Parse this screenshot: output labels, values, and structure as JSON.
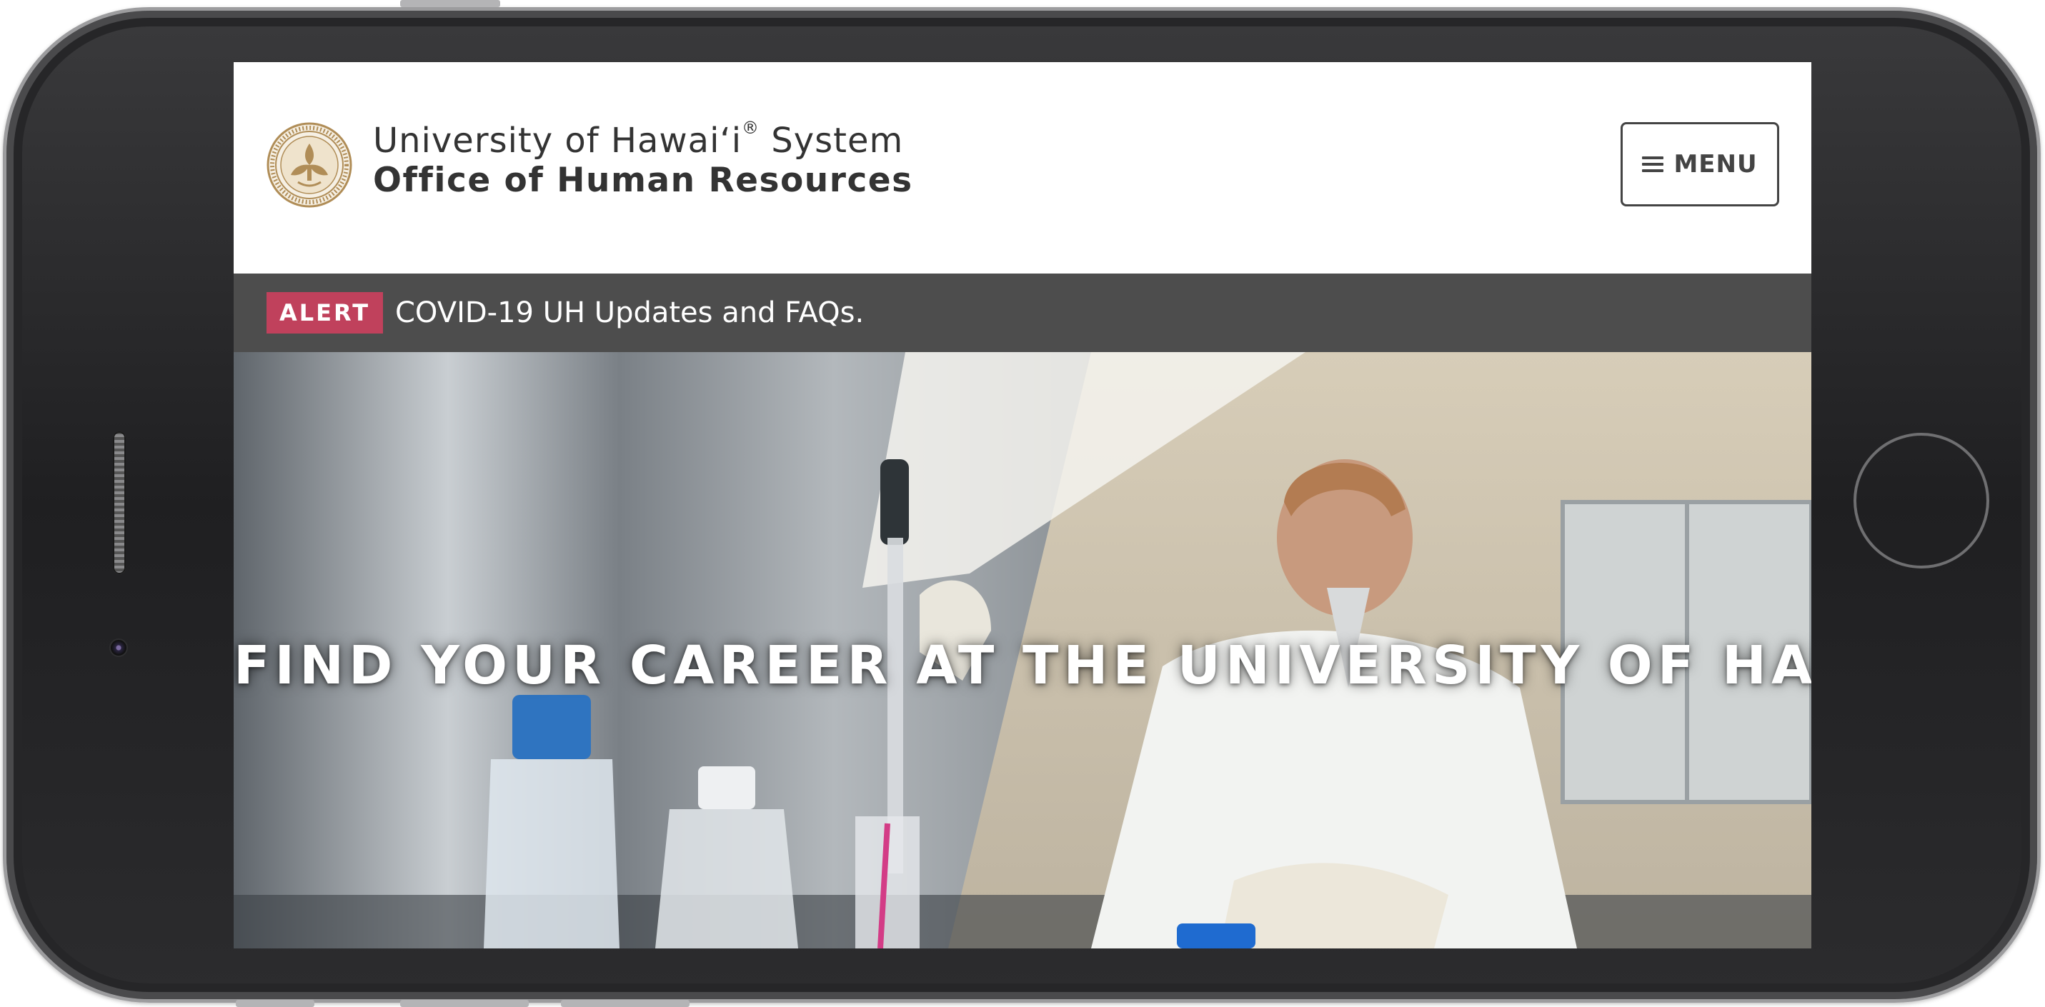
{
  "header": {
    "brand_line1": "University of Hawaiʻi",
    "brand_registered": "®",
    "brand_line1_suffix": "System",
    "brand_line2": "Office of Human Resources",
    "seal_icon": "university-seal-icon",
    "menu_label": "MENU"
  },
  "alert": {
    "badge": "ALERT",
    "message": "COVID-19 UH Updates and FAQs.",
    "badge_color": "#c0415c",
    "bar_color": "#4d4d4d"
  },
  "hero": {
    "title": "FIND YOUR CAREER AT THE UNIVERSITY OF HAWAIʻI"
  },
  "colors": {
    "seal_gold": "#b08d57",
    "text_dark": "#333333"
  }
}
